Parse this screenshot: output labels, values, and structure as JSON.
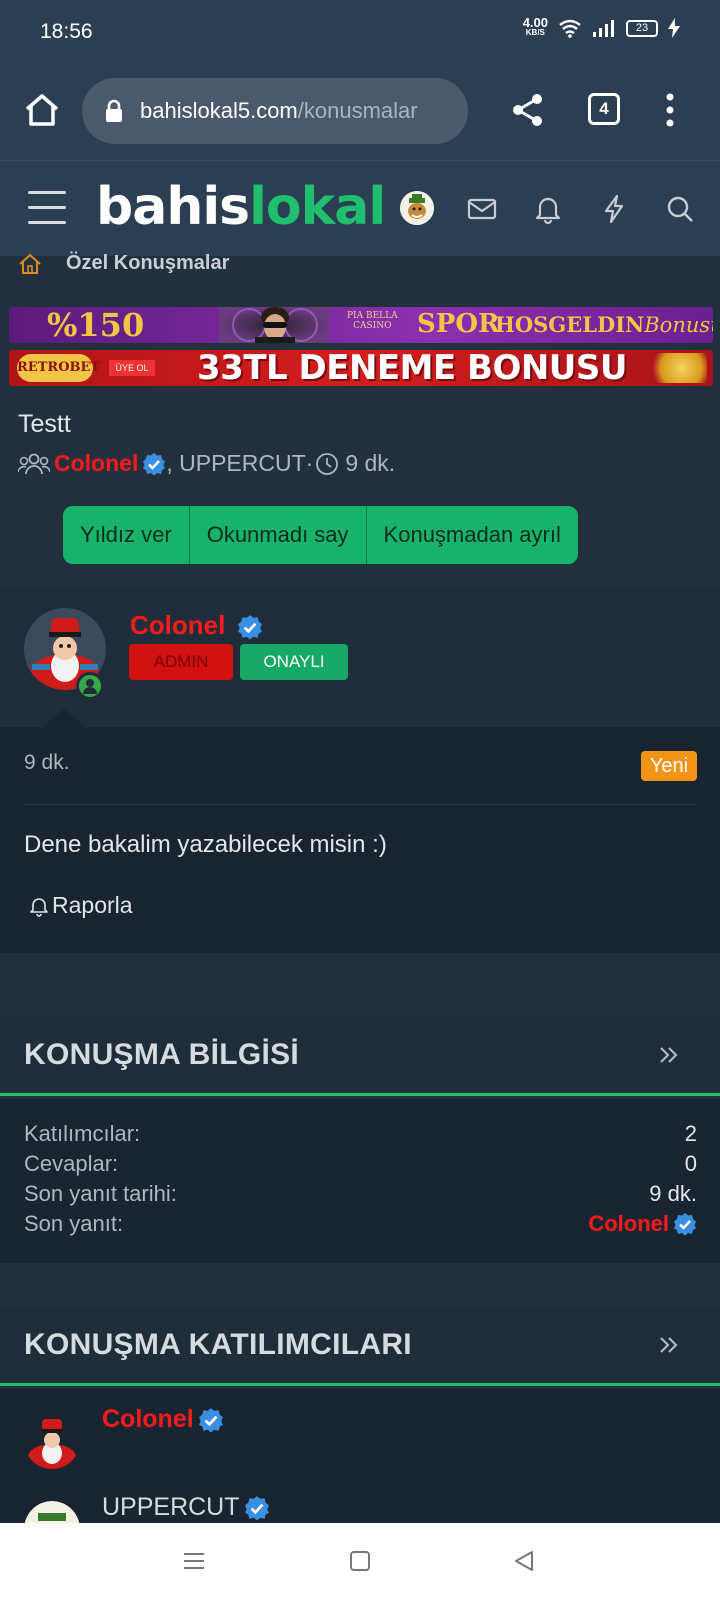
{
  "status_bar": {
    "time": "18:56",
    "net_speed_value": "4.00",
    "net_speed_unit": "KB/S",
    "battery": "23"
  },
  "browser": {
    "url_host": "bahislokal5.com",
    "url_path": "/konusmalar",
    "tab_count": "4"
  },
  "site": {
    "logo_part1": "bahis",
    "logo_part2": "lokal",
    "brand_color": "#1fbf6e"
  },
  "breadcrumb": {
    "label": "Özel Konuşmalar"
  },
  "banners": {
    "banner1": {
      "percent": "%150",
      "casino_line1": "PIA BELLA",
      "casino_line2": "CASINO",
      "spor": "SPOR",
      "hosgeldin": "HOSGELDIN",
      "bonusu": "Bonusu"
    },
    "banner2": {
      "logo": "RETROBET",
      "uye_ol": "ÜYE OL",
      "text": "33TL DENEME BONUSU"
    }
  },
  "conversation": {
    "title": "Testt",
    "starter": "Colonel",
    "other": ", UPPERCUT",
    "separator": " · ",
    "time": "9 dk."
  },
  "actions": {
    "star": "Yıldız ver",
    "mark_unread": "Okunmadı say",
    "leave": "Konuşmadan ayrıl"
  },
  "message": {
    "username": "Colonel",
    "badge_admin": "ADMIN",
    "badge_verified": "ONAYLI",
    "time": "9 dk.",
    "new_label": "Yeni",
    "text": "Dene bakalim yazabilecek misin :)",
    "report": "Raporla"
  },
  "info_panel": {
    "title": "KONUŞMA BİLGİSİ",
    "rows": [
      {
        "label": "Katılımcılar:",
        "value": "2"
      },
      {
        "label": "Cevaplar:",
        "value": "0"
      },
      {
        "label": "Son yanıt tarihi:",
        "value": "9 dk."
      },
      {
        "label": "Son yanıt:",
        "value": "Colonel"
      }
    ]
  },
  "participants_panel": {
    "title": "KONUŞMA KATILIMCILARI",
    "items": [
      {
        "name": "Colonel"
      },
      {
        "name": "UPPERCUT"
      }
    ]
  },
  "colors": {
    "admin_red": "#ff1a1a",
    "accent_green": "#1fbf6e",
    "new_orange": "#f29418",
    "verified_blue": "#3b8fe0"
  }
}
